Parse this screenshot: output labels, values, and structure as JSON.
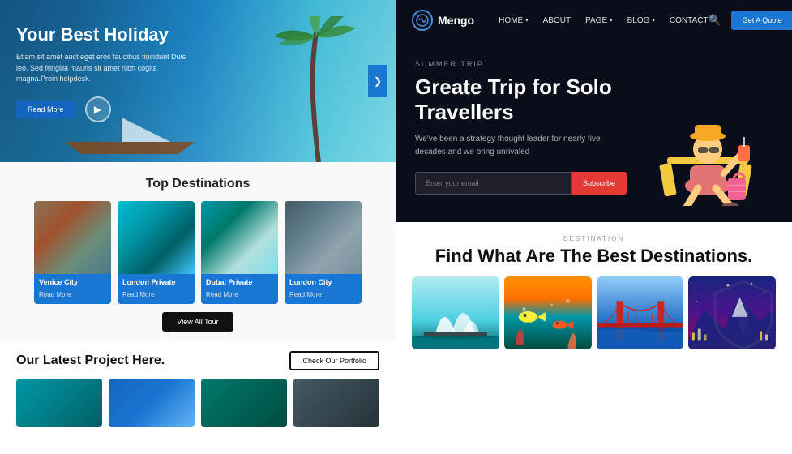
{
  "left": {
    "hero": {
      "title": "Your Best Holiday",
      "description": "Etiam sit amet auct eget eros faucibus tincidunt Duis leo. Sed fringilla mauris sit amet nibh cogita magna.Proin helpdesk.",
      "read_more_btn": "Read More",
      "next_icon": "❯"
    },
    "destinations": {
      "section_title": "Top Destinations",
      "cards": [
        {
          "name": "Venice City",
          "link": "Read More",
          "color": "venice"
        },
        {
          "name": "London Private",
          "link": "Read More",
          "color": "london"
        },
        {
          "name": "Dubai Private",
          "link": "Read More",
          "color": "dubai"
        },
        {
          "name": "London City",
          "link": "Read More",
          "color": "london2"
        }
      ],
      "view_all_btn": "View All Tour"
    },
    "latest": {
      "title": "Our Latest Project Here.",
      "portfolio_btn": "Check Our Portfolio",
      "projects": [
        {
          "color": "proj-1"
        },
        {
          "color": "proj-2"
        },
        {
          "color": "proj-3"
        },
        {
          "color": "proj-4"
        }
      ]
    }
  },
  "right": {
    "nav": {
      "logo_letter": "m",
      "logo_name": "Mengo",
      "links": [
        {
          "label": "HOME",
          "has_dropdown": true
        },
        {
          "label": "ABOUT",
          "has_dropdown": false
        },
        {
          "label": "PAGE",
          "has_dropdown": true
        },
        {
          "label": "BLOG",
          "has_dropdown": true
        },
        {
          "label": "CONTACT",
          "has_dropdown": false
        }
      ],
      "quote_btn": "Get A Quote"
    },
    "hero": {
      "trip_label": "SUMMER TRIP",
      "title": "Greate Trip for Solo Travellers",
      "description": "We've been a strategy thought leader for nearly five decades and we bring unrivaled",
      "email_placeholder": "Enter your email",
      "subscribe_btn": "Subscribe"
    },
    "destinations": {
      "label": "DESTINATION",
      "title": "Find What Are The Best Destinations.",
      "cards": [
        {
          "color": "r-1"
        },
        {
          "color": "r-2"
        },
        {
          "color": "r-3"
        },
        {
          "color": "r-4"
        }
      ]
    }
  }
}
